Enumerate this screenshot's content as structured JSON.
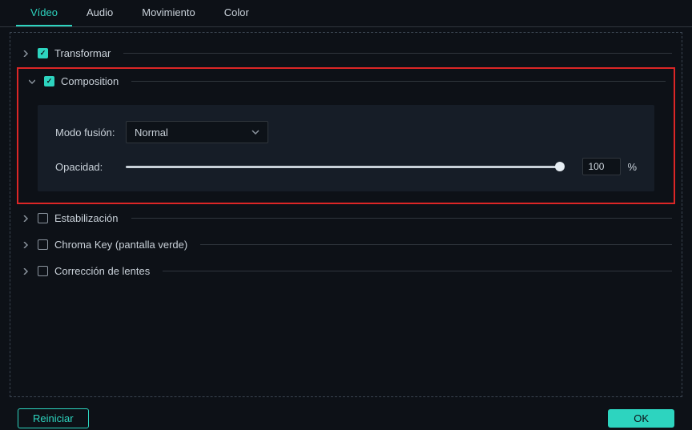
{
  "tabs": {
    "video": "Vídeo",
    "audio": "Audio",
    "movimiento": "Movimiento",
    "color": "Color"
  },
  "sections": {
    "transformar": "Transformar",
    "composition": "Composition",
    "estabilizacion": "Estabilización",
    "chromakey": "Chroma Key (pantalla verde)",
    "correccion": "Corrección de lentes"
  },
  "composition": {
    "blend_label": "Modo fusión:",
    "blend_value": "Normal",
    "opacity_label": "Opacidad:",
    "opacity_value": "100",
    "percent": "%"
  },
  "footer": {
    "reset": "Reiniciar",
    "ok": "OK"
  }
}
